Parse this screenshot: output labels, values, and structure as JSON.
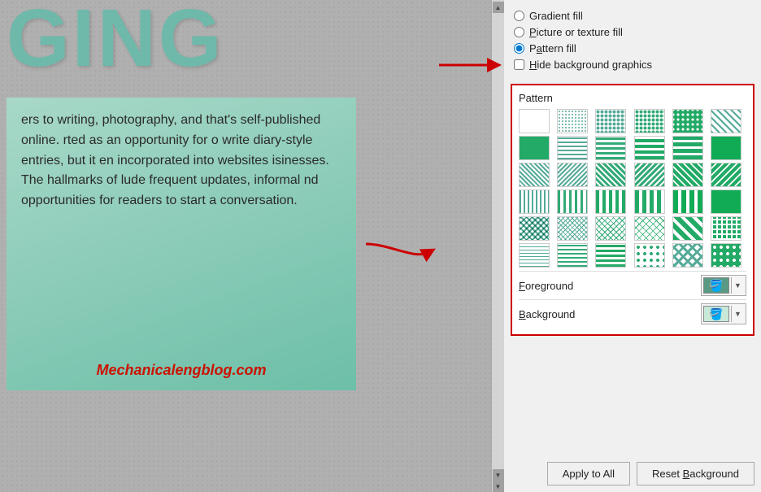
{
  "slide": {
    "title": "GING",
    "content_text": "ers to writing, photography, and that's self-published online. rted as an opportunity for o write diary-style entries, but it en incorporated into websites isinesses. The hallmarks of lude frequent updates, informal nd opportunities for readers to start a conversation.",
    "website_url": "Mechanicalengblog.com"
  },
  "fill_options": {
    "gradient_fill": "Gradient fill",
    "picture_fill": "Picture or texture fill",
    "pattern_fill": "Pattern fill",
    "hide_bg": "Hide background graphics"
  },
  "pattern": {
    "label": "Pattern",
    "count": 36
  },
  "color_options": {
    "foreground_label": "Foreground",
    "background_label": "Background"
  },
  "buttons": {
    "apply_all": "Apply to All",
    "reset_bg": "Reset Background"
  },
  "radio_states": {
    "gradient_fill": false,
    "picture_fill": false,
    "pattern_fill": true
  }
}
